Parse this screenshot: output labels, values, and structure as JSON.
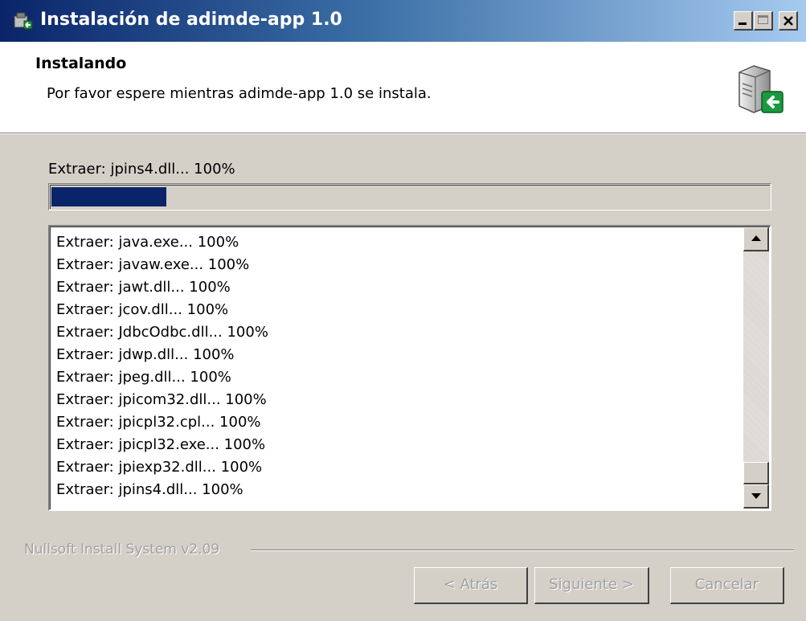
{
  "window": {
    "title": "Instalación de adimde-app 1.0",
    "controls": {
      "minimize": "_",
      "maximize": "□",
      "close": "×"
    }
  },
  "header": {
    "title": "Instalando",
    "subtitle": "Por favor espere mientras adimde-app 1.0 se instala.",
    "icon": "installer-computer-icon"
  },
  "progress": {
    "status": "Extraer: jpins4.dll... 100%",
    "fraction": 0.16,
    "color": "#0a246a"
  },
  "log": {
    "lines": [
      "Extraer: java.exe... 100%",
      "Extraer: javaw.exe... 100%",
      "Extraer: jawt.dll... 100%",
      "Extraer: jcov.dll... 100%",
      "Extraer: JdbcOdbc.dll... 100%",
      "Extraer: jdwp.dll... 100%",
      "Extraer: jpeg.dll... 100%",
      "Extraer: jpicom32.dll... 100%",
      "Extraer: jpicpl32.cpl... 100%",
      "Extraer: jpicpl32.exe... 100%",
      "Extraer: jpiexp32.dll... 100%",
      "Extraer: jpins4.dll... 100%"
    ]
  },
  "footer": {
    "branding": "Nullsoft Install System v2.09",
    "buttons": {
      "back": "< Atrás",
      "next": "Siguiente >",
      "cancel": "Cancelar"
    }
  },
  "colors": {
    "titlebar_start": "#0a246a",
    "titlebar_end": "#a6caf0",
    "face": "#d4d0c8"
  }
}
